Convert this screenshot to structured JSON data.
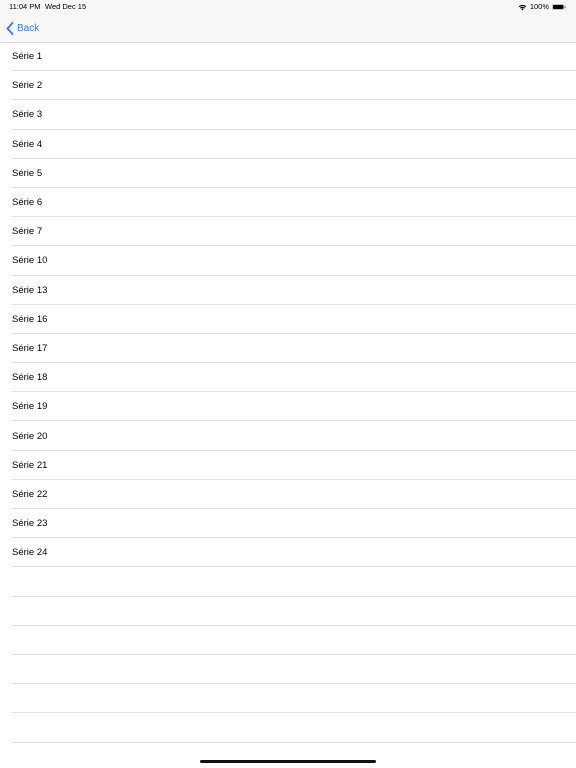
{
  "status_bar": {
    "time": "11:04 PM",
    "date": "Wed Dec 15",
    "battery_percent": "100%",
    "icons": [
      "wifi-icon",
      "battery-icon"
    ]
  },
  "nav": {
    "back_label": "Back",
    "back_icon": "chevron-left-icon",
    "accent_color": "#2f7bf5"
  },
  "list": {
    "items": [
      {
        "label": "Série 1"
      },
      {
        "label": "Série 2"
      },
      {
        "label": "Série 3"
      },
      {
        "label": "Série 4"
      },
      {
        "label": "Série 5"
      },
      {
        "label": "Série 6"
      },
      {
        "label": "Série 7"
      },
      {
        "label": "Série 10"
      },
      {
        "label": "Série 13"
      },
      {
        "label": "Série 16"
      },
      {
        "label": "Série 17"
      },
      {
        "label": "Série 18"
      },
      {
        "label": "Série 19"
      },
      {
        "label": "Série 20"
      },
      {
        "label": "Série 21"
      },
      {
        "label": "Série 22"
      },
      {
        "label": "Série 23"
      },
      {
        "label": "Série 24"
      }
    ]
  }
}
